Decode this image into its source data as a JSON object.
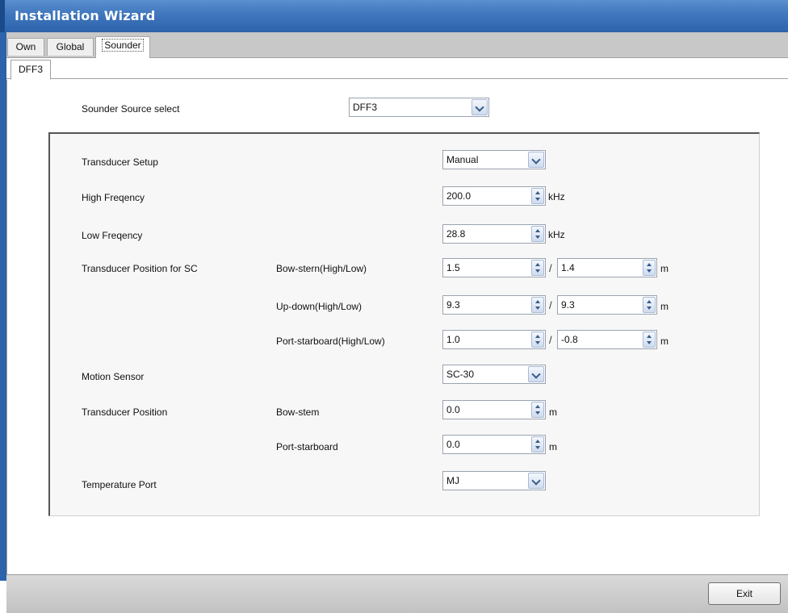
{
  "window": {
    "title": "Installation Wizard"
  },
  "outer_tabs": [
    "Own",
    "Global",
    "Sounder"
  ],
  "inner_tab": "DFF3",
  "sounder_source": {
    "label": "Sounder Source select",
    "value": "DFF3"
  },
  "transducer_setup": {
    "label": "Transducer Setup",
    "value": "Manual"
  },
  "high_freq": {
    "label": "High Freqency",
    "value": "200.0",
    "unit": "kHz"
  },
  "low_freq": {
    "label": "Low Freqency",
    "value": "28.8",
    "unit": "kHz"
  },
  "tp_sc": {
    "label": "Transducer Position for SC",
    "rows": [
      {
        "label": "Bow-stern(High/Low)",
        "high": "1.5",
        "low": "1.4",
        "unit": "m"
      },
      {
        "label": "Up-down(High/Low)",
        "high": "9.3",
        "low": "9.3",
        "unit": "m"
      },
      {
        "label": "Port-starboard(High/Low)",
        "high": "1.0",
        "low": "-0.8",
        "unit": "m"
      }
    ],
    "separator": "/"
  },
  "motion_sensor": {
    "label": "Motion Sensor",
    "value": "SC-30"
  },
  "transducer_position": {
    "label": "Transducer Position",
    "rows": [
      {
        "label": "Bow-stem",
        "value": "0.0",
        "unit": "m"
      },
      {
        "label": "Port-starboard",
        "value": "0.0",
        "unit": "m"
      }
    ]
  },
  "temperature_port": {
    "label": "Temperature Port",
    "value": "MJ"
  },
  "footer": {
    "exit_label": "Exit"
  },
  "colors": {
    "titlebar": "#3f76bd",
    "panel": "#f7f7f7",
    "statusbar": "#c8c8c8"
  }
}
